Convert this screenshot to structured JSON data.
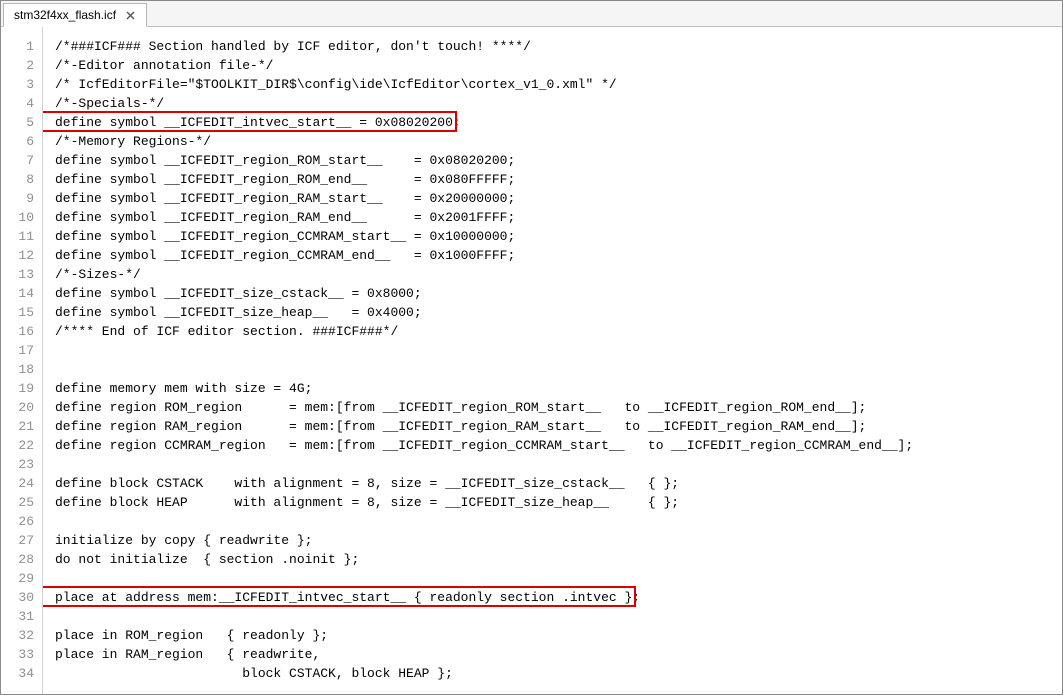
{
  "tab": {
    "title": "stm32f4xx_flash.icf"
  },
  "code": {
    "lines": [
      "/*###ICF### Section handled by ICF editor, don't touch! ****/",
      "/*-Editor annotation file-*/",
      "/* IcfEditorFile=\"$TOOLKIT_DIR$\\config\\ide\\IcfEditor\\cortex_v1_0.xml\" */",
      "/*-Specials-*/",
      "define symbol __ICFEDIT_intvec_start__ = 0x08020200;",
      "/*-Memory Regions-*/",
      "define symbol __ICFEDIT_region_ROM_start__    = 0x08020200;",
      "define symbol __ICFEDIT_region_ROM_end__      = 0x080FFFFF;",
      "define symbol __ICFEDIT_region_RAM_start__    = 0x20000000;",
      "define symbol __ICFEDIT_region_RAM_end__      = 0x2001FFFF;",
      "define symbol __ICFEDIT_region_CCMRAM_start__ = 0x10000000;",
      "define symbol __ICFEDIT_region_CCMRAM_end__   = 0x1000FFFF;",
      "/*-Sizes-*/",
      "define symbol __ICFEDIT_size_cstack__ = 0x8000;",
      "define symbol __ICFEDIT_size_heap__   = 0x4000;",
      "/**** End of ICF editor section. ###ICF###*/",
      "",
      "",
      "define memory mem with size = 4G;",
      "define region ROM_region      = mem:[from __ICFEDIT_region_ROM_start__   to __ICFEDIT_region_ROM_end__];",
      "define region RAM_region      = mem:[from __ICFEDIT_region_RAM_start__   to __ICFEDIT_region_RAM_end__];",
      "define region CCMRAM_region   = mem:[from __ICFEDIT_region_CCMRAM_start__   to __ICFEDIT_region_CCMRAM_end__];",
      "",
      "define block CSTACK    with alignment = 8, size = __ICFEDIT_size_cstack__   { };",
      "define block HEAP      with alignment = 8, size = __ICFEDIT_size_heap__     { };",
      "",
      "initialize by copy { readwrite };",
      "do not initialize  { section .noinit };",
      "",
      "place at address mem:__ICFEDIT_intvec_start__ { readonly section .intvec };",
      "",
      "place in ROM_region   { readonly };",
      "place in RAM_region   { readwrite,",
      "                        block CSTACK, block HEAP };"
    ],
    "highlight_lines": [
      5,
      30
    ]
  },
  "highlight_color": "#d90000"
}
